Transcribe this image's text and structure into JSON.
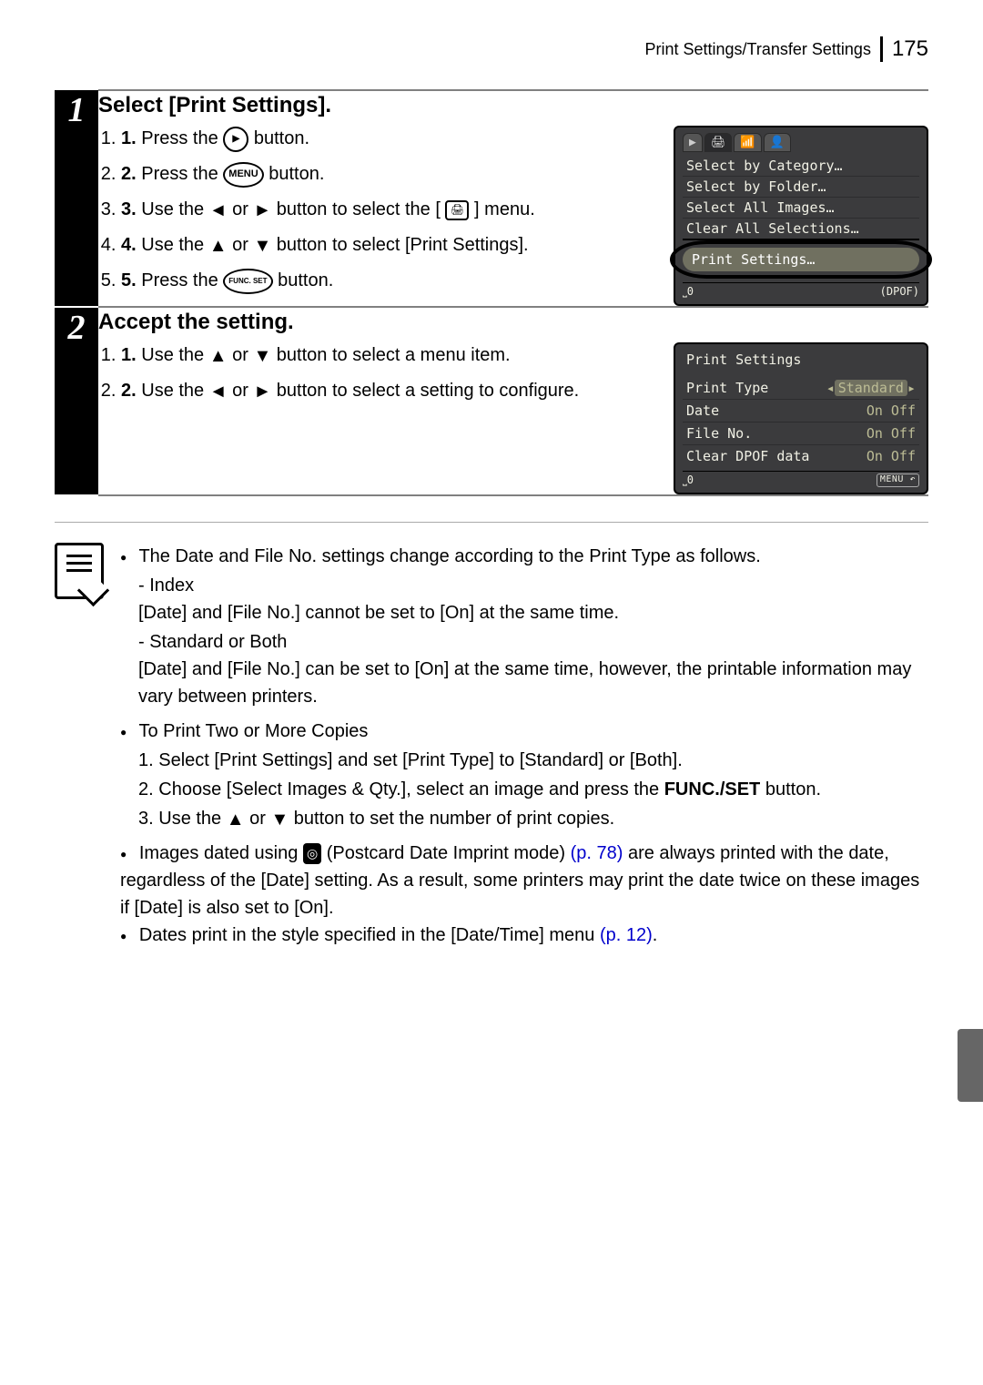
{
  "header": {
    "section": "Print Settings/Transfer Settings",
    "page": "175"
  },
  "steps": [
    {
      "num": "1",
      "title": "Select [Print Settings].",
      "items": [
        {
          "pre": "Press the ",
          "icon": "playback",
          "post": " button."
        },
        {
          "pre": "Press the ",
          "icon": "menu",
          "post": " button."
        },
        {
          "pre": "Use the ",
          "arrows": "lr",
          "mid": " button to select the [",
          "icon2": "print-menu",
          "post": "] menu."
        },
        {
          "pre": "Use the ",
          "arrows": "ud",
          "mid": " button to select [Print Settings].",
          "post": ""
        },
        {
          "pre": "Press the ",
          "icon": "funcset",
          "post": " button."
        }
      ],
      "screen": {
        "tabs": [
          "▶",
          "🖨",
          "📶",
          "👤"
        ],
        "activeTab": 1,
        "lines": [
          "Select by Category…",
          "Select by Folder…",
          "Select All Images…",
          "Clear All Selections…"
        ],
        "highlight": "Print Settings…",
        "footLeft": "⎵0",
        "footRight": "(DPOF)"
      }
    },
    {
      "num": "2",
      "title": "Accept the setting.",
      "items": [
        {
          "pre": "Use the ",
          "arrows": "ud",
          "mid": " button to select a menu item.",
          "post": ""
        },
        {
          "pre": "Use the ",
          "arrows": "lr",
          "mid": " button to select a setting to configure.",
          "post": ""
        }
      ],
      "screen2": {
        "title": "Print Settings",
        "rows": [
          {
            "k": "Print Type",
            "v": "Standard",
            "sel": true
          },
          {
            "k": "Date",
            "v": "On Off"
          },
          {
            "k": "File No.",
            "v": "On Off"
          },
          {
            "k": "Clear DPOF data",
            "v": "On Off"
          }
        ],
        "footLeft": "⎵0",
        "footRight": "MENU ↶"
      }
    }
  ],
  "notes": {
    "b1": "The Date and File No. settings change according to the Print Type as follows.",
    "b1a_t": "Index",
    "b1a_d": "[Date] and [File No.] cannot be set to [On] at the same time.",
    "b1b_t": "Standard or Both",
    "b1b_d": "[Date] and [File No.] can be set to [On] at the same time, however, the printable information may vary between printers.",
    "b2": "To Print Two or More Copies",
    "b2_1": "Select [Print Settings] and set [Print Type] to [Standard] or [Both].",
    "b2_2a": "Choose [Select Images & Qty.], select an image and press the ",
    "b2_2b": "FUNC./SET",
    "b2_2c": " button.",
    "b2_3a": "Use the ",
    "b2_3b": " button to set the number of print copies.",
    "b3a": "Images dated using ",
    "b3b": " (Postcard Date Imprint mode) ",
    "b3c": "(p. 78)",
    "b3d": " are always printed with the date, regardless of the [Date] setting. As a result, some printers may print the date twice on these images if [Date] is also set to [On].",
    "b4a": "Dates print in the style specified in the [Date/Time] menu ",
    "b4b": "(p. 12)",
    "b4c": "."
  },
  "icons": {
    "menu_label": "MENU",
    "funcset_label": "FUNC.\nSET",
    "postcard": "◎"
  }
}
